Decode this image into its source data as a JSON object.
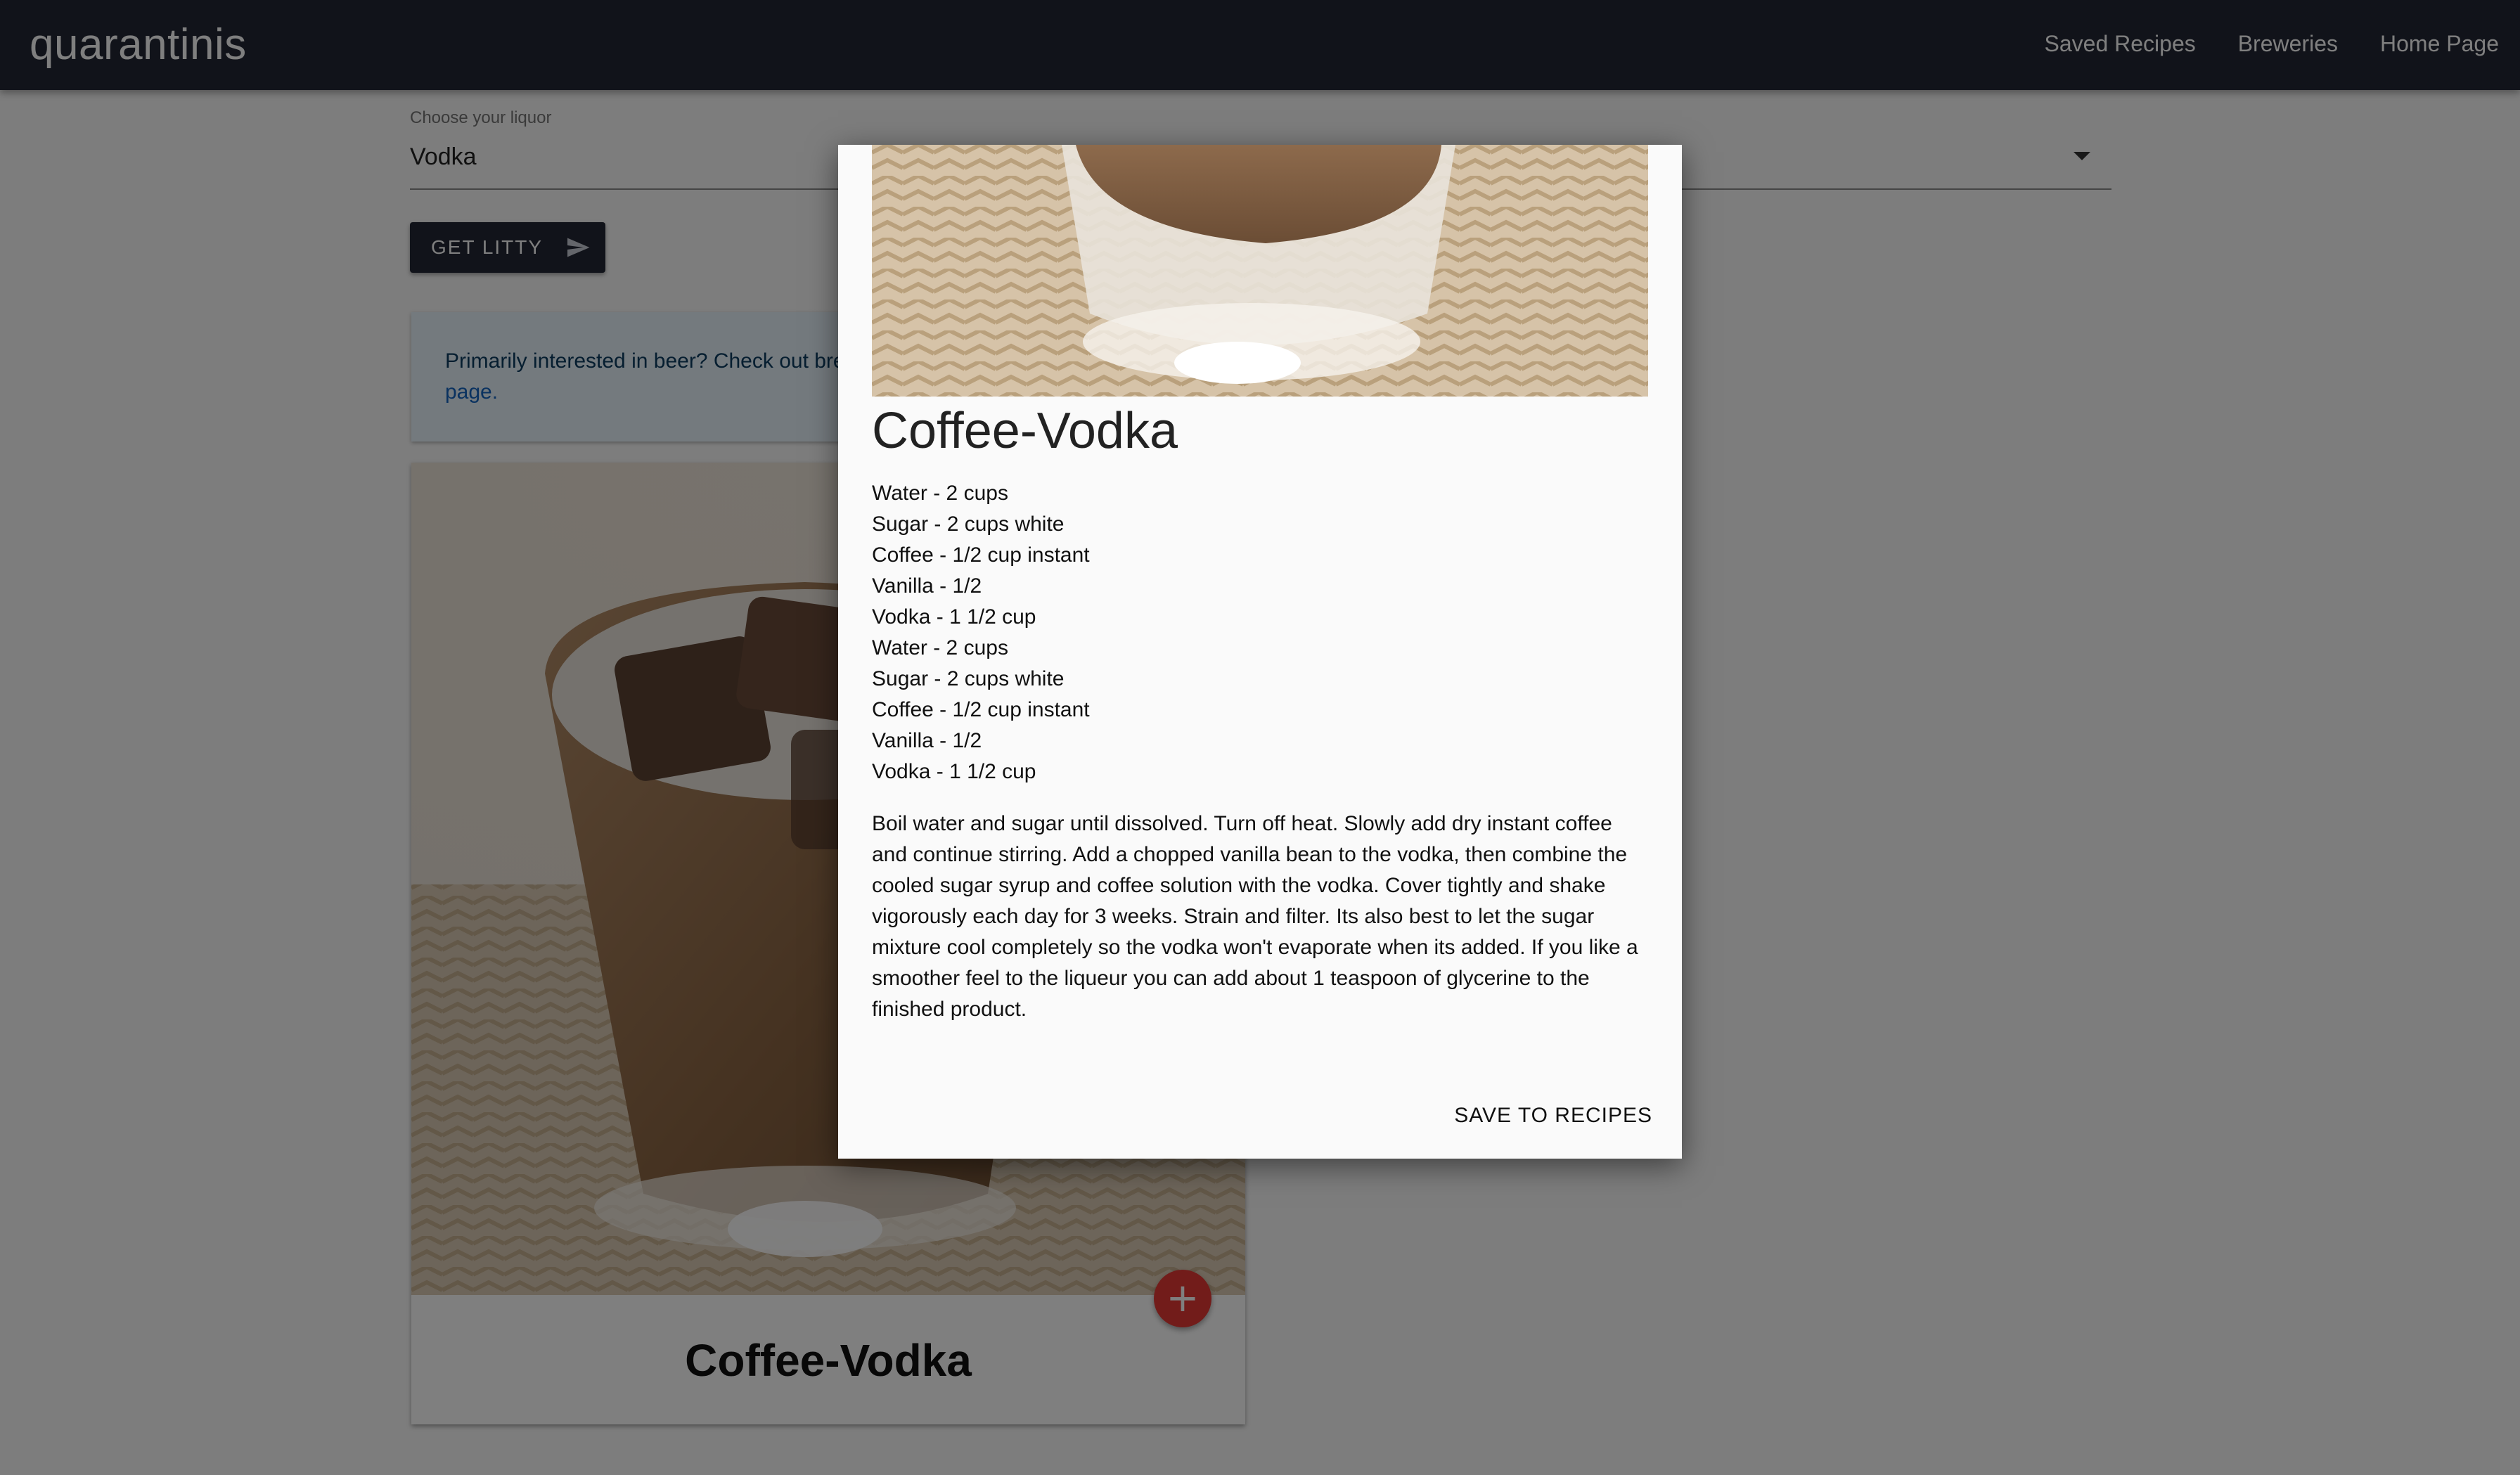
{
  "app": {
    "title": "quarantinis"
  },
  "nav": {
    "items": [
      {
        "label": "Saved Recipes"
      },
      {
        "label": "Breweries"
      },
      {
        "label": "Home Page"
      }
    ]
  },
  "liquor_select": {
    "label": "Choose your liquor",
    "value": "Vodka"
  },
  "get_litty_button": {
    "label": "GET LITTY",
    "icon": "send-icon"
  },
  "alert": {
    "text": "Primarily interested in beer? Check out bre",
    "link_text": "page."
  },
  "card": {
    "title": "Coffee-Vodka",
    "add_icon": "plus-icon",
    "add_symbol": "+"
  },
  "modal": {
    "title": "Coffee-Vodka",
    "ingredients": [
      "Water - 2 cups",
      "Sugar - 2 cups white",
      "Coffee - 1/2 cup instant",
      "Vanilla - 1/2",
      "Vodka - 1 1/2 cup",
      "Water - 2 cups",
      "Sugar - 2 cups white",
      "Coffee - 1/2 cup instant",
      "Vanilla - 1/2",
      "Vodka - 1 1/2 cup"
    ],
    "instructions": "Boil water and sugar until dissolved. Turn off heat. Slowly add dry instant coffee and continue stirring. Add a chopped vanilla bean to the vodka, then combine the cooled sugar syrup and coffee solution with the vodka. Cover tightly and shake vigorously each day for 3 weeks. Strain and filter. Its also best to let the sugar mixture cool completely so the vodka won't evaporate when its added. If you like a smoother feel to the liqueur you can add about 1 teaspoon of glycerine to the finished product.",
    "save_label": "SAVE TO RECIPES"
  },
  "colors": {
    "appbar": "#232735",
    "fab": "#e53935",
    "alert_bg": "#e8f4fd",
    "link": "#1565c0"
  }
}
